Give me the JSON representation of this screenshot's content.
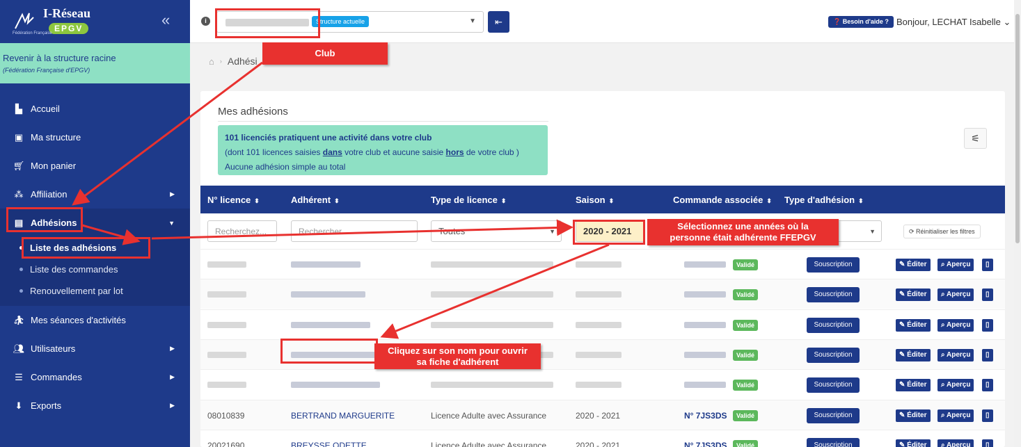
{
  "sidebar": {
    "brand_name": "I-Réseau",
    "brand_badge": "EPGV",
    "brand_sub": "Fédération Française",
    "collapse_icon": "double-chevron-left-icon",
    "root_title": "Revenir à la structure racine",
    "root_sub": "(Fédération Française d'EPGV)",
    "items": [
      {
        "label": "Accueil",
        "icon": "dashboard-icon"
      },
      {
        "label": "Ma structure",
        "icon": "building-icon"
      },
      {
        "label": "Mon panier",
        "icon": "cart-icon"
      },
      {
        "label": "Affiliation",
        "icon": "network-icon"
      },
      {
        "label": "Adhésions",
        "icon": "id-card-icon"
      },
      {
        "label": "Mes séances d'activités",
        "icon": "running-icon"
      },
      {
        "label": "Utilisateurs",
        "icon": "users-icon"
      },
      {
        "label": "Commandes",
        "icon": "list-icon"
      },
      {
        "label": "Exports",
        "icon": "download-icon"
      }
    ],
    "sub_items": [
      "Liste des adhésions",
      "Liste des commandes",
      "Renouvellement par lot"
    ]
  },
  "header": {
    "structure_badge": "Structure actuelle",
    "help_label": "Besoin d'aide ?",
    "user_greeting": "Bonjour, LECHAT Isabelle"
  },
  "breadcrumb": {
    "current": "Adhési"
  },
  "card": {
    "title": "Mes adhésions",
    "alert_line1": "101 licenciés pratiquent une activité dans votre club",
    "alert_line2_a": "(dont 101 licences saisies ",
    "alert_line2_b": "dans",
    "alert_line2_c": " votre club et aucune saisie ",
    "alert_line2_d": "hors",
    "alert_line2_e": " de votre club )",
    "alert_line3": "Aucune adhésion simple au total"
  },
  "table": {
    "headers": [
      "N° licence",
      "Adhérent",
      "Type de licence",
      "Saison",
      "Commande associée",
      "Type d'adhésion"
    ],
    "filter_placeholder_1": "Recherchez...",
    "filter_placeholder_2": "Rechercher...",
    "filter_type": "Toutes",
    "filter_saison": "2020 - 2021",
    "reset_label": "Réinitialiser les filtres",
    "status": "Validé",
    "souscription": "Souscription",
    "edit": "Éditer",
    "preview": "Aperçu",
    "rows": [
      {
        "licence": "08010839",
        "name": "BERTRAND MARGUERITE",
        "type": "Licence Adulte avec Assurance",
        "saison": "2020 - 2021",
        "cmd": "N° 7JS3DS"
      },
      {
        "licence": "20021690",
        "name": "BREYSSE ODETTE",
        "type": "Licence Adulte avec Assurance",
        "saison": "2020 - 2021",
        "cmd": "N° 7JS3DS"
      }
    ]
  },
  "annotations": {
    "club": "Club",
    "saison_1": "Sélectionnez une années où la",
    "saison_2": "personne était adhérente FFEPGV",
    "name_1": "Cliquez sur son nom pour ouvrir",
    "name_2": "sa fiche d'adhérent"
  },
  "colors": {
    "primary": "#1e3a8a",
    "accent_green": "#8ee0c4",
    "success": "#5cb85c",
    "annotation": "#e8312f"
  }
}
